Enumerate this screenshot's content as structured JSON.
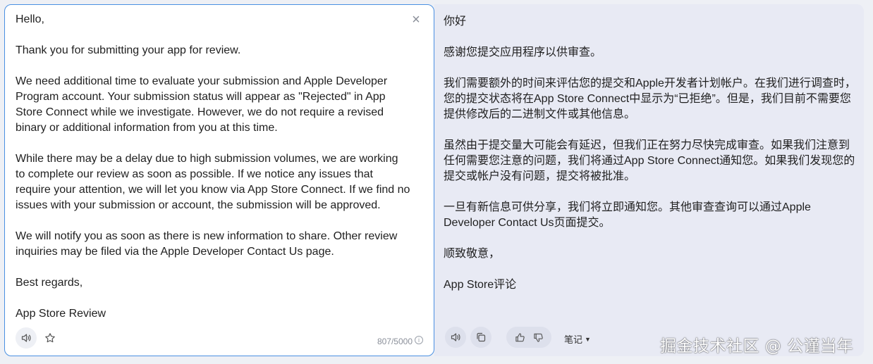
{
  "source": {
    "paragraphs": [
      "Hello,",
      "Thank you for submitting your app for review.",
      "We need additional time to evaluate your submission and Apple Developer Program account. Your submission status will appear as \"Rejected\" in App Store Connect while we investigate. However, we do not require a revised binary or additional information from you at this time.",
      "While there may be a delay due to high submission volumes, we are working to complete our review as soon as possible. If we notice any issues that require your attention, we will let you know via App Store Connect. If we find no issues with your submission or account, the submission will be approved.",
      "We will notify you as soon as there is new information to share. Other review inquiries may be filed via the Apple Developer Contact Us page.",
      "Best regards,",
      "App Store Review"
    ],
    "char_count": "807/5000",
    "close_glyph": "×"
  },
  "target": {
    "paragraphs": [
      "你好",
      "感谢您提交应用程序以供审查。",
      "我们需要额外的时间来评估您的提交和Apple开发者计划帐户。在我们进行调查时，您的提交状态将在App Store Connect中显示为“已拒绝”。但是，我们目前不需要您提供修改后的二进制文件或其他信息。",
      "虽然由于提交量大可能会有延迟，但我们正在努力尽快完成审查。如果我们注意到任何需要您注意的问题，我们将通过App Store Connect通知您。如果我们发现您的提交或帐户没有问题，提交将被批准。",
      "一旦有新信息可供分享，我们将立即通知您。其他审查查询可以通过Apple Developer Contact Us页面提交。",
      "顺致敬意，",
      "App Store评论"
    ],
    "notes_label": "笔记"
  },
  "watermark": "掘金技术社区 @ 公谨当年",
  "icons": {
    "source_speak": "speaker-icon",
    "source_favorite": "star-icon",
    "target_speak": "speaker-icon",
    "target_copy": "copy-icon",
    "thumbs_up": "thumbs-up-icon",
    "thumbs_down": "thumbs-down-icon"
  },
  "colors": {
    "accent_border": "#4a90e2",
    "target_bg": "#e8eaf4"
  }
}
